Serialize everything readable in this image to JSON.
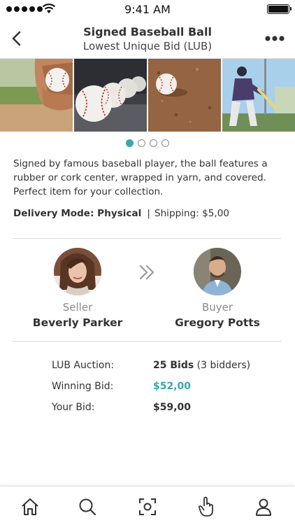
{
  "status_bar": {
    "time": "9:41 AM"
  },
  "header": {
    "title": "Signed Baseball Ball",
    "subtitle": "Lowest Unique Bid (LUB)"
  },
  "gallery": {
    "photos": [
      "baseball-in-hand-photo",
      "baseballs-row-photo",
      "baseball-on-dirt-photo",
      "batter-swinging-photo"
    ],
    "page_count": 4,
    "active_page": 1
  },
  "description": "Signed by famous baseball player, the ball features a rubber or cork center, wrapped in yarn, and covered. Perfect item for your collection.",
  "delivery": {
    "mode_label": "Delivery Mode: Physical",
    "separator": "|",
    "shipping_label": "Shipping: $5,00"
  },
  "seller": {
    "role": "Seller",
    "name": "Beverly Parker"
  },
  "buyer": {
    "role": "Buyer",
    "name": "Gregory Potts"
  },
  "auction": {
    "type_label": "LUB Auction:",
    "bids_count": "25 Bids",
    "bidders": "(3 bidders)",
    "winning_label": "Winning Bid:",
    "winning_value": "$52,00",
    "your_label": "Your Bid:",
    "your_value": "$59,00"
  },
  "tabs": [
    "home-icon",
    "search-icon",
    "scan-icon",
    "bid-hand-icon",
    "profile-icon"
  ],
  "colors": {
    "accent": "#3aa5ad",
    "text": "#333333",
    "muted": "#8a8a8a"
  }
}
